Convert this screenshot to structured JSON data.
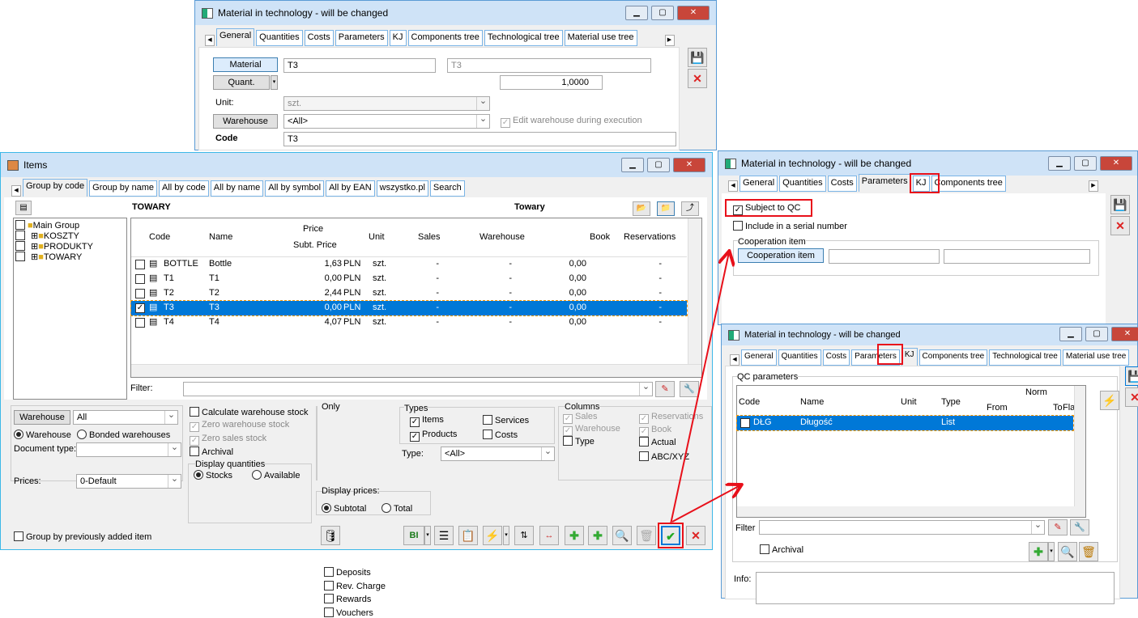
{
  "top_window": {
    "title": "Material in technology - will be changed",
    "tabs": [
      "General",
      "Quantities",
      "Costs",
      "Parameters",
      "KJ",
      "Components tree",
      "Technological tree",
      "Material use tree"
    ],
    "active_tab": "General",
    "material_btn": "Material",
    "material_code": "T3",
    "material_name": "T3",
    "quant_btn": "Quant.",
    "quantity": "1,0000",
    "unit_label": "Unit:",
    "unit": "szt.",
    "warehouse_btn": "Warehouse",
    "warehouse": "<All>",
    "edit_wh_label": "Edit warehouse during execution",
    "code_label": "Code",
    "code": "T3"
  },
  "items_window": {
    "title": "Items",
    "tabs": [
      "Group by code",
      "Group by name",
      "All by code",
      "All by name",
      "All by symbol",
      "All by EAN",
      "wszystko.pl",
      "Search"
    ],
    "active_tab": "Group by code",
    "tree_header": "TOWARY",
    "grid_header": "Towary",
    "tree": [
      {
        "label": "Main Group",
        "level": 0
      },
      {
        "label": "KOSZTY",
        "level": 1
      },
      {
        "label": "PRODUKTY",
        "level": 1
      },
      {
        "label": "TOWARY",
        "level": 1
      }
    ],
    "columns": {
      "code": "Code",
      "name": "Name",
      "price": "Price",
      "subt_price": "Subt. Price",
      "unit": "Unit",
      "sales": "Sales",
      "warehouse": "Warehouse",
      "book": "Book",
      "reservations": "Reservations"
    },
    "rows": [
      {
        "code": "BOTTLE",
        "name": "Bottle",
        "price": "1,63",
        "cur": "PLN",
        "unit": "szt.",
        "sales": "-",
        "warehouse": "-",
        "book": "0,00",
        "res": "-",
        "checked": false,
        "selected": false
      },
      {
        "code": "T1",
        "name": "T1",
        "price": "0,00",
        "cur": "PLN",
        "unit": "szt.",
        "sales": "-",
        "warehouse": "-",
        "book": "0,00",
        "res": "-",
        "checked": false,
        "selected": false
      },
      {
        "code": "T2",
        "name": "T2",
        "price": "2,44",
        "cur": "PLN",
        "unit": "szt.",
        "sales": "-",
        "warehouse": "-",
        "book": "0,00",
        "res": "-",
        "checked": false,
        "selected": false
      },
      {
        "code": "T3",
        "name": "T3",
        "price": "0,00",
        "cur": "PLN",
        "unit": "szt.",
        "sales": "-",
        "warehouse": "-",
        "book": "0,00",
        "res": "-",
        "checked": true,
        "selected": true
      },
      {
        "code": "T4",
        "name": "T4",
        "price": "4,07",
        "cur": "PLN",
        "unit": "szt.",
        "sales": "-",
        "warehouse": "-",
        "book": "0,00",
        "res": "-",
        "checked": false,
        "selected": false
      }
    ],
    "filter_label": "Filter:",
    "filter_value": "",
    "warehouse_btn": "Warehouse",
    "warehouse_value": "All",
    "radio_warehouse": "Warehouse",
    "radio_bonded": "Bonded warehouses",
    "doc_type_label": "Document type:",
    "prices_label": "Prices:",
    "prices_value": "0-Default",
    "calc_wh_stock": "Calculate warehouse stock",
    "zero_wh_stock": "Zero warehouse stock",
    "zero_sales_stock": "Zero sales stock",
    "archival": "Archival",
    "display_qty_label": "Display quantities",
    "stocks": "Stocks",
    "available": "Available",
    "only_label": "Only",
    "only": [
      "Deposits",
      "Rev. Charge",
      "Rewards",
      "Vouchers"
    ],
    "types_label": "Types",
    "items": "Items",
    "products": "Products",
    "services": "Services",
    "costs": "Costs",
    "type_label": "Type:",
    "type_value": "<All>",
    "display_prices_label": "Display prices:",
    "subtotal": "Subtotal",
    "total": "Total",
    "columns_label": "Columns",
    "col_sales": "Sales",
    "col_warehouse": "Warehouse",
    "col_type": "Type",
    "col_reservations": "Reservations",
    "col_book": "Book",
    "col_actual": "Actual",
    "col_abc": "ABC/XYZ",
    "group_prev": "Group by previously added item",
    "bi_label": "BI"
  },
  "params_window": {
    "title": "Material in technology - will be changed",
    "tabs": [
      "General",
      "Quantities",
      "Costs",
      "Parameters",
      "KJ",
      "Components tree"
    ],
    "active_tab": "Parameters",
    "subject_qc": "Subject to QC",
    "include_serial": "Include in a serial number",
    "coop_group": "Cooperation item",
    "coop_btn": "Cooperation item"
  },
  "kj_window": {
    "title": "Material in technology - will be changed",
    "tabs": [
      "General",
      "Quantities",
      "Costs",
      "Parameters",
      "KJ",
      "Components tree",
      "Technological tree",
      "Material use tree"
    ],
    "active_tab": "KJ",
    "qc_group": "QC parameters",
    "columns": {
      "code": "Code",
      "name": "Name",
      "unit": "Unit",
      "type": "Type",
      "norm": "Norm",
      "from": "From",
      "to": "To",
      "flag": "Flag"
    },
    "rows": [
      {
        "code": "DŁG",
        "name": "Długość",
        "unit": "",
        "type": "List",
        "from": "",
        "to": "",
        "flag": ""
      }
    ],
    "filter_label": "Filter",
    "archival": "Archival",
    "info_label": "Info:"
  },
  "colors": {
    "accent": "#0078d7",
    "highlight": "#e8101a",
    "titlebar": "#cfe3f7"
  }
}
